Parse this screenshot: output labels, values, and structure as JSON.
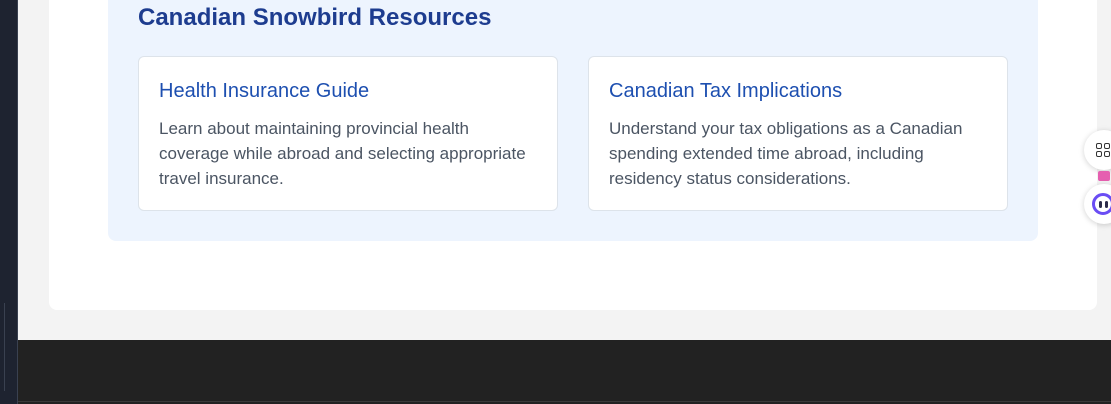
{
  "resources": {
    "title": "Canadian Snowbird Resources",
    "cards": [
      {
        "title": "Health Insurance Guide",
        "text": "Learn about maintaining provincial health coverage while abroad and selecting appropriate travel insurance."
      },
      {
        "title": "Canadian Tax Implications",
        "text": "Understand your tax obligations as a Canadian spending extended time abroad, including residency status considerations."
      }
    ]
  },
  "floating_toolbar": {
    "icons": [
      "apps-grid-icon",
      "extension-badge-icon",
      "assistant-icon"
    ]
  },
  "colors": {
    "heading": "#1d3c8f",
    "link": "#1d4fb0",
    "panel_bg": "#edf4fe",
    "footer_bg": "#222222",
    "page_bg": "#f3f3f3"
  }
}
